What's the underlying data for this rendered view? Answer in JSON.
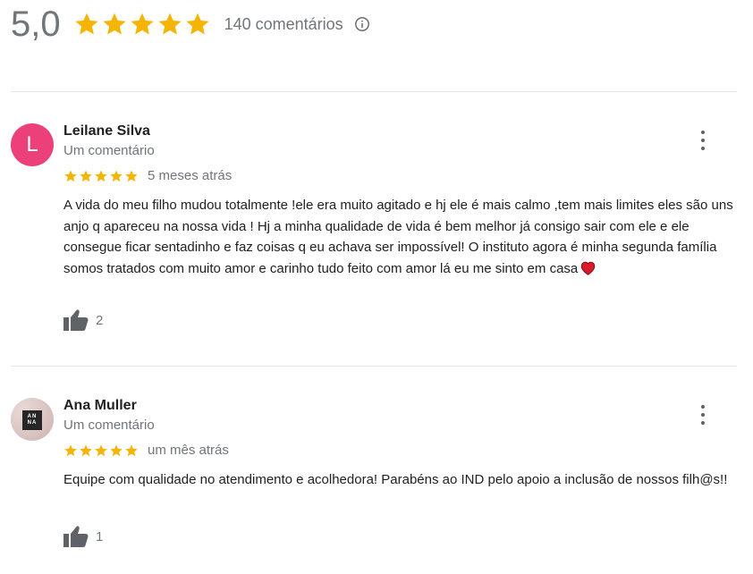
{
  "summary": {
    "score": "5,0",
    "stars": 5,
    "count_label": "140 comentários"
  },
  "colors": {
    "star": "#f4b400",
    "secondary_text": "#70757a",
    "avatar_leilane": "#ec407a",
    "heart": "#d81b2a"
  },
  "icons": {
    "info": "info-icon",
    "menu": "more-vert-icon",
    "like": "thumbs-up-icon",
    "heart": "red-heart-emoji"
  },
  "reviews": [
    {
      "avatar_letter": "L",
      "name": "Leilane Silva",
      "subtitle": "Um comentário",
      "stars": 5,
      "date": "5 meses atrás",
      "text": "A vida do meu filho mudou totalmente !ele era muito agitado e hj ele é mais calmo ,tem mais limites eles são uns anjo q apareceu  na nossa vida ! Hj a minha qualidade de vida é bem melhor já consigo sair com ele e ele consegue ficar sentadinho e faz coisas q eu achava ser impossível! O instituto agora é minha segunda família somos tratados com muito amor e carinho tudo feito com amor lá eu me sinto em casa",
      "likes": "2"
    },
    {
      "avatar_logo_line1": "AN",
      "avatar_logo_line2": "NA",
      "name": "Ana Muller",
      "subtitle": "Um comentário",
      "stars": 5,
      "date": "um mês atrás",
      "text": "Equipe com qualidade no atendimento e acolhedora! Parabéns ao IND pelo apoio a inclusão de nossos filh@s!!",
      "likes": "1"
    }
  ]
}
